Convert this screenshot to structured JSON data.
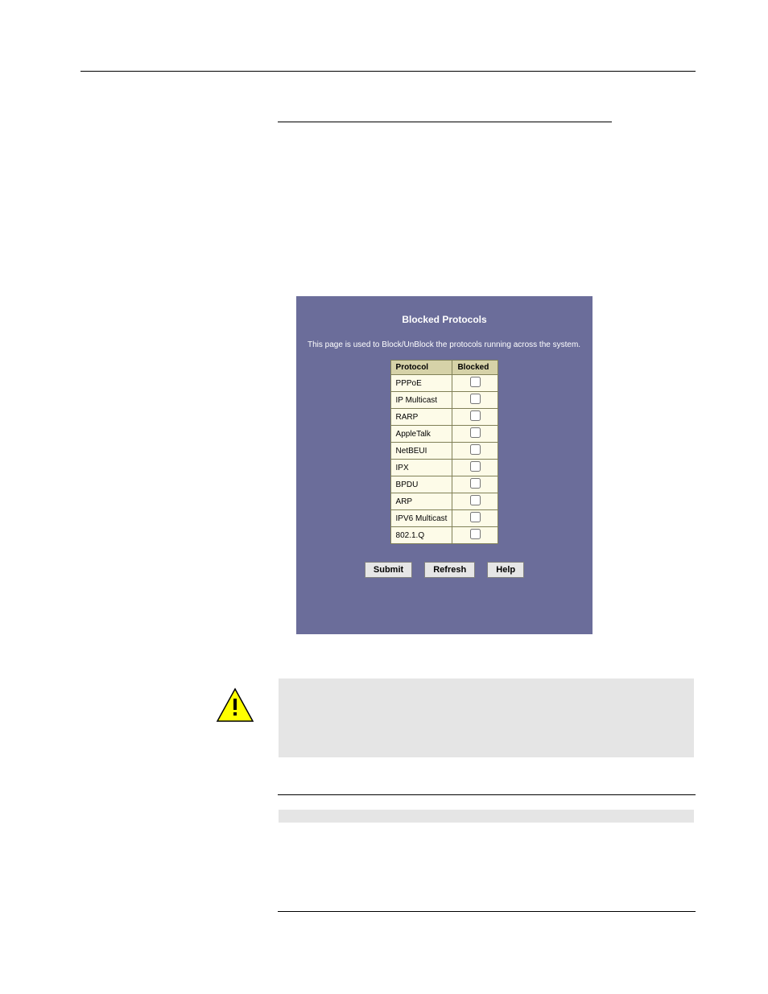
{
  "panel": {
    "title": "Blocked Protocols",
    "description": "This page is used to Block/UnBlock the protocols running across the system.",
    "headers": {
      "protocol": "Protocol",
      "blocked": "Blocked"
    },
    "rows": [
      {
        "name": "PPPoE"
      },
      {
        "name": "IP Multicast"
      },
      {
        "name": "RARP"
      },
      {
        "name": "AppleTalk"
      },
      {
        "name": "NetBEUI"
      },
      {
        "name": "IPX"
      },
      {
        "name": "BPDU"
      },
      {
        "name": "ARP"
      },
      {
        "name": "IPV6 Multicast"
      },
      {
        "name": "802.1.Q"
      }
    ],
    "buttons": {
      "submit": "Submit",
      "refresh": "Refresh",
      "help": "Help"
    }
  }
}
